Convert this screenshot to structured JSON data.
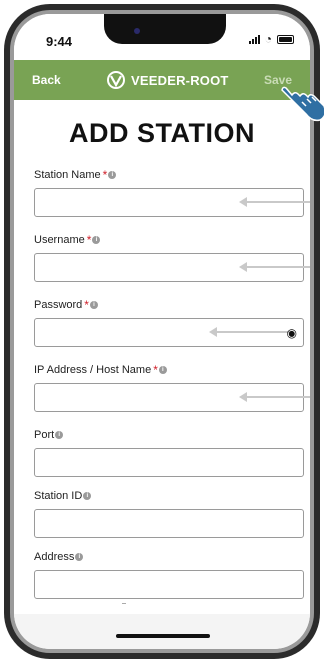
{
  "status_bar": {
    "time": "9:44",
    "signal_icon": "signal-bars-icon",
    "wifi_icon": "wifi-icon",
    "battery_icon": "battery-icon"
  },
  "nav": {
    "back_label": "Back",
    "brand_name": "VEEDER-ROOT",
    "brand_icon": "veeder-root-logo-icon",
    "save_label": "Save",
    "bar_color": "#79a354"
  },
  "form": {
    "title": "ADD STATION",
    "fields": [
      {
        "label": "Station Name",
        "required_mark": "*",
        "value": "",
        "placeholder": ""
      },
      {
        "label": "Username",
        "required_mark": "*",
        "value": "",
        "placeholder": ""
      },
      {
        "label": "Password",
        "required_mark": "*",
        "value": "",
        "placeholder": ""
      },
      {
        "label": "IP Address / Host Name",
        "required_mark": "*",
        "value": "",
        "placeholder": ""
      },
      {
        "label": "Port",
        "value": "",
        "placeholder": ""
      },
      {
        "label": "Station ID",
        "value": "",
        "placeholder": ""
      },
      {
        "label": "Address",
        "value": "",
        "placeholder": ""
      }
    ],
    "info_icon": "info-icon",
    "password_toggle_icon": "eye-icon",
    "required_color": "#d0202a"
  },
  "pointer_icon": "hand-pointer-icon"
}
